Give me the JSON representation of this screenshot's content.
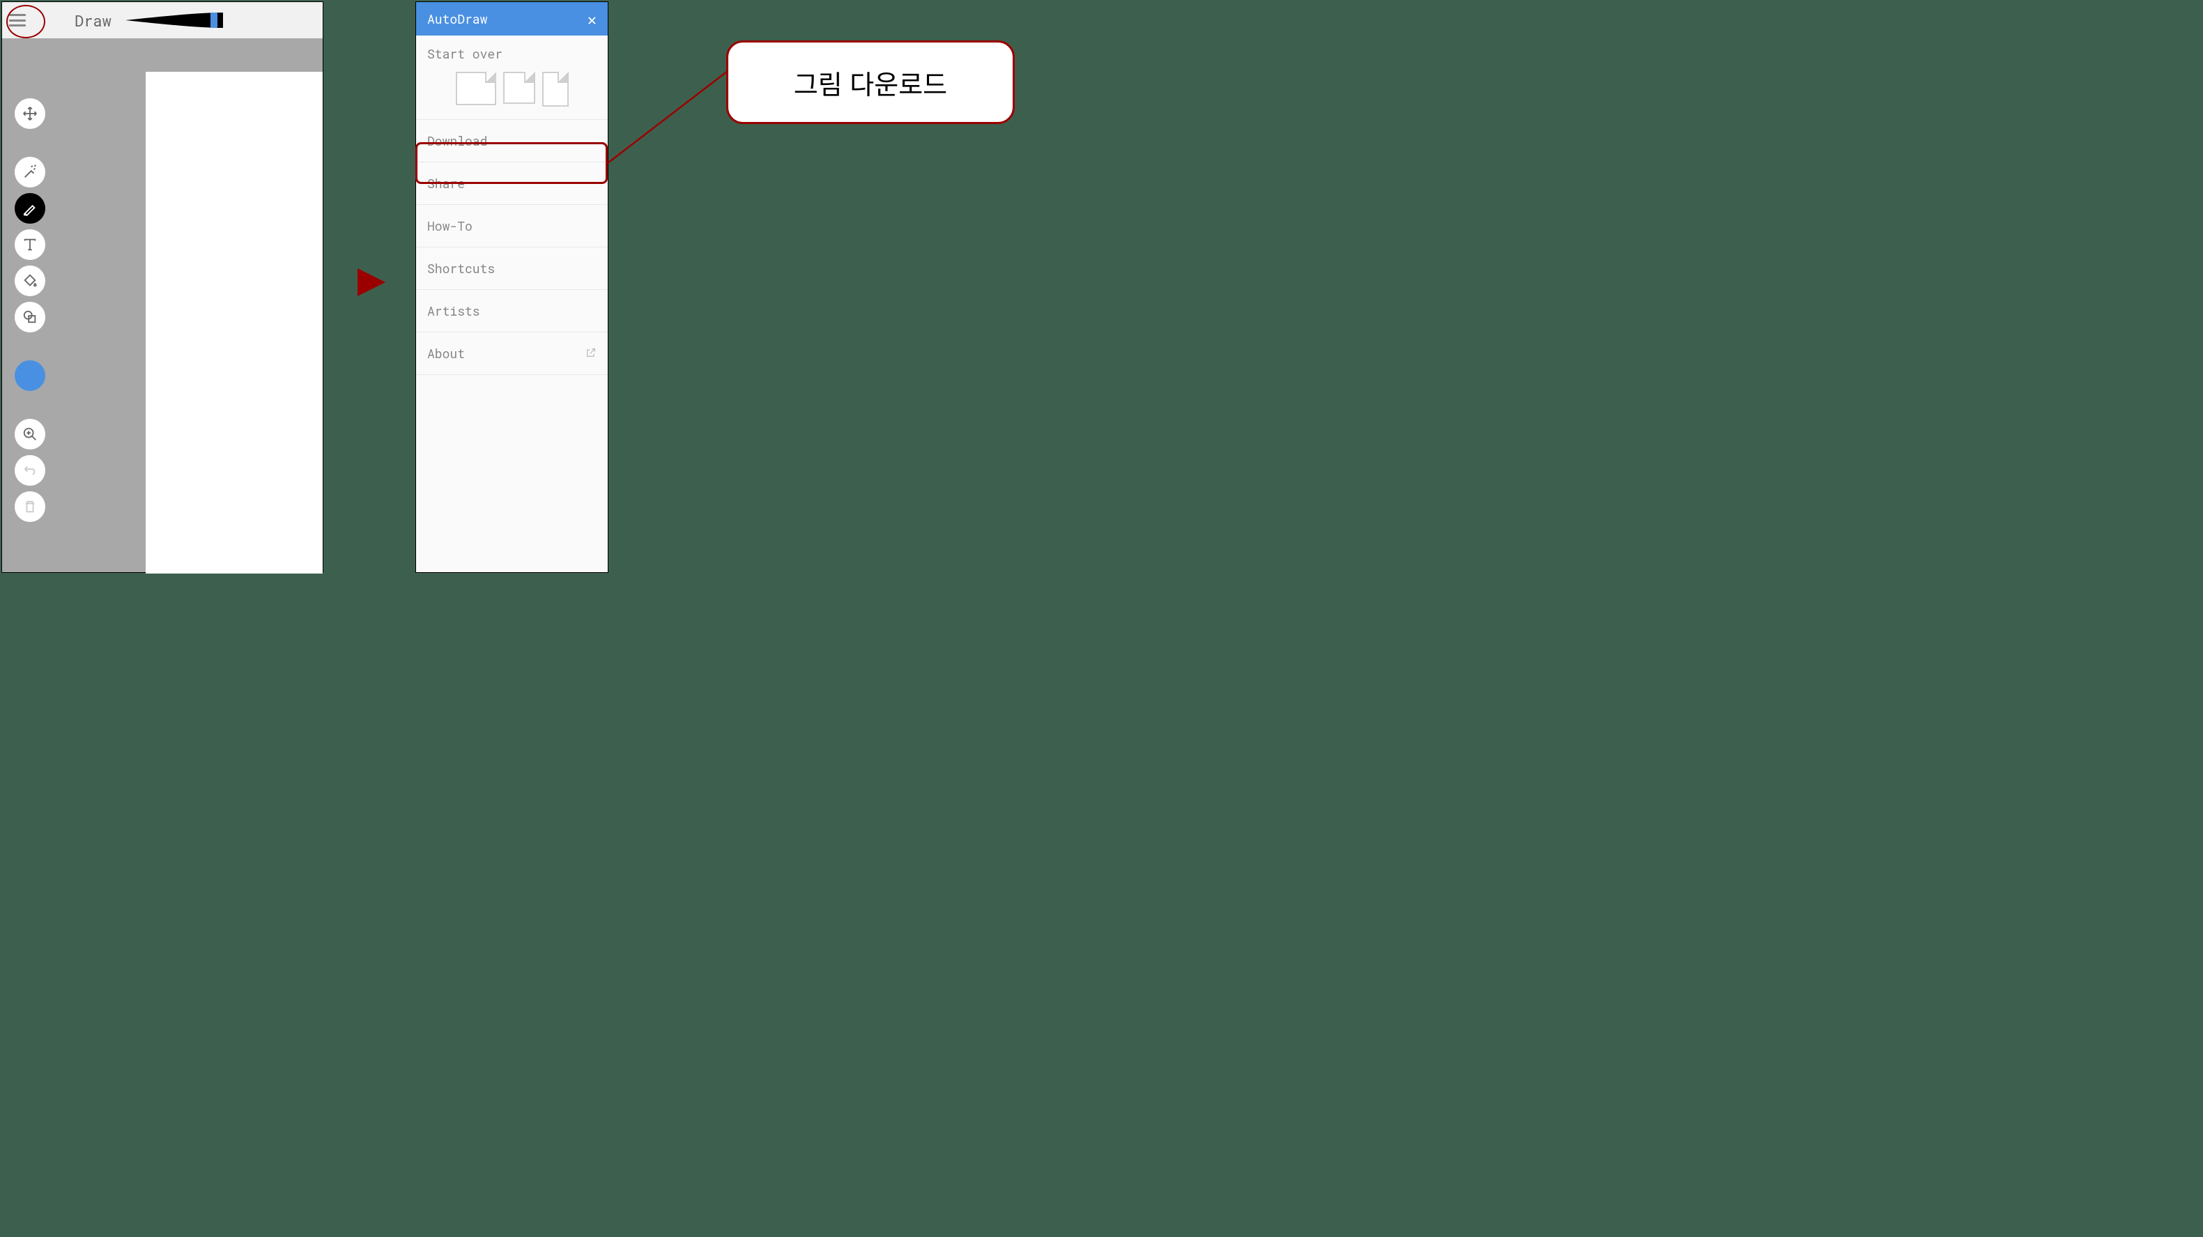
{
  "app": {
    "tool_label": "Draw",
    "tools": {
      "move": "move-tool",
      "autodraw": "autodraw-tool",
      "draw": "draw-tool",
      "text": "text-tool",
      "fill": "fill-tool",
      "shape": "shape-tool",
      "color": "color-picker",
      "zoom": "zoom-tool",
      "undo": "undo-tool",
      "delete": "delete-tool"
    }
  },
  "menu": {
    "title": "AutoDraw",
    "start_over": "Start over",
    "items": {
      "download": "Download",
      "share": "Share",
      "howto": "How-To",
      "shortcuts": "Shortcuts",
      "artists": "Artists",
      "about": "About"
    }
  },
  "callout": {
    "text": "그림 다운로드"
  },
  "colors": {
    "accent": "#4a90e2",
    "highlight": "#9a0000"
  }
}
